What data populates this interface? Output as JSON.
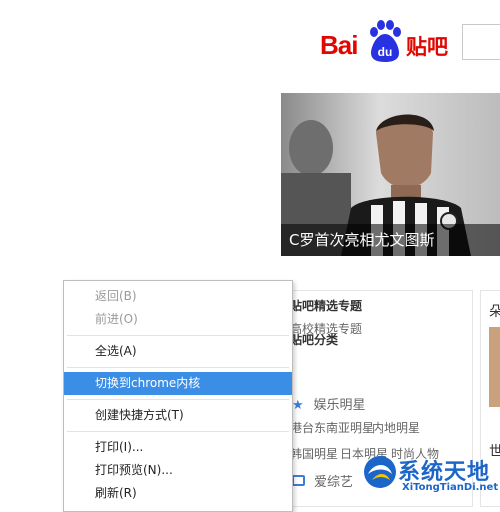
{
  "header": {
    "logo_bai": "Bai",
    "logo_du": "du",
    "logo_tieba": "贴吧"
  },
  "banner": {
    "caption": "C罗首次亮相尤文图斯"
  },
  "panel": {
    "featured_title": "贴吧精选专题",
    "featured_link": "高校精选专题",
    "category_title": "贴吧分类",
    "category_ent": "娱乐明星",
    "tags_row1": [
      "港台东南亚明星",
      "内地明星"
    ],
    "tags_row2": [
      "韩国明星",
      "日本明星",
      "时尚人物"
    ],
    "category_variety": "爱综艺"
  },
  "right_card": {
    "title": "朵",
    "word": "世"
  },
  "context_menu": {
    "items": [
      {
        "label": "返回(B)",
        "state": "disabled"
      },
      {
        "label": "前进(O)",
        "state": "disabled"
      },
      {
        "label": "全选(A)",
        "state": "normal"
      },
      {
        "label": "切换到chrome内核",
        "state": "highlight"
      },
      {
        "label": "创建快捷方式(T)",
        "state": "normal"
      },
      {
        "label": "打印(I)...",
        "state": "normal"
      },
      {
        "label": "打印预览(N)...",
        "state": "normal"
      },
      {
        "label": "刷新(R)",
        "state": "normal"
      }
    ]
  },
  "watermark": {
    "text": "系统天地",
    "url": "XiTongTianDi.net"
  },
  "colors": {
    "brand_red": "#e10601",
    "baidu_blue": "#2932e1",
    "menu_highlight": "#3a8ee6",
    "watermark_blue": "#1c66c9"
  }
}
